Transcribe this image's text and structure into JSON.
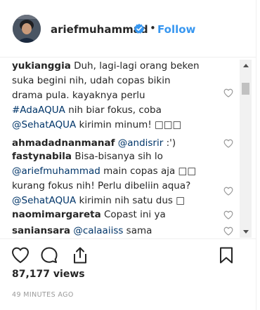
{
  "header": {
    "username": "ariefmuhammad",
    "separator": "•",
    "follow_label": "Follow"
  },
  "comments": [
    {
      "user": "yukianggia",
      "text_1": " Duh, lagi-lagi orang beken",
      "text_2": "suka begini nih, udah copas bikin",
      "text_3": "drama pula. kayaknya perlu",
      "hashtag": "#AdaAQUA",
      "text_4": " nih biar fokus, coba",
      "mention": "@SehatAQUA",
      "text_5": " kirimin minum! □□□"
    },
    {
      "user": "ahmadadnanmanaf",
      "mention": "@andisrir",
      "text": " :')"
    },
    {
      "user": "fastynabila",
      "text_1": " Bisa-bisanya sih lo",
      "mention_1": "@ariefmuhammad",
      "text_2": " main copas aja □□",
      "text_3": "kurang fokus nih! Perlu dibeliin aqua?",
      "mention_2": "@SehatAQUA",
      "text_4": " kirimin nih satu dus □"
    },
    {
      "user": "naomimargareta",
      "text": " Copast ini ya"
    },
    {
      "user": "saniansara",
      "mention": "@calaaiiss",
      "text": " sama"
    }
  ],
  "views": "87,177 views",
  "time": "49 MINUTES AGO",
  "colors": {
    "link": "#003569",
    "follow": "#3897f0",
    "verified": "#3897f0",
    "muted": "#999999",
    "text": "#262626"
  },
  "icons": [
    "verified-badge-icon",
    "heart-icon",
    "comment-icon",
    "share-icon",
    "bookmark-icon",
    "scroll-up-arrow-icon",
    "scroll-down-arrow-icon"
  ]
}
